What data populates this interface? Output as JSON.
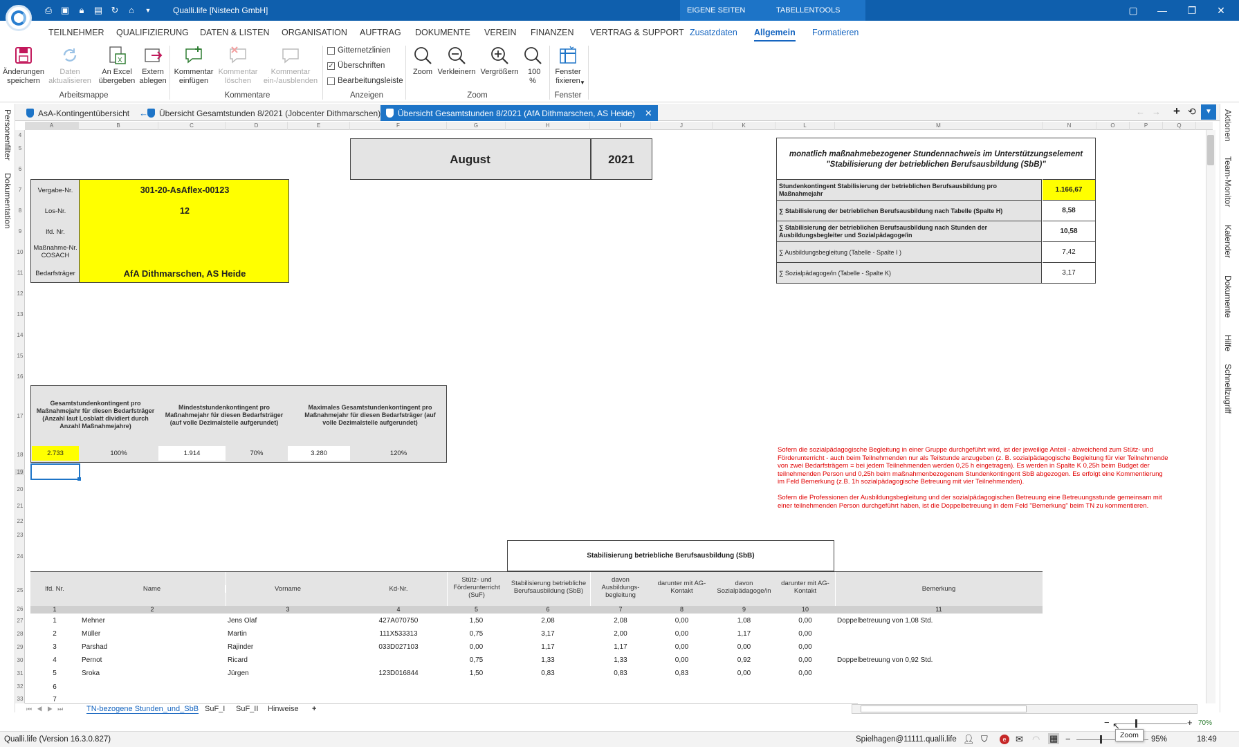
{
  "app": {
    "title": "Qualli.life [Nistech GmbH]",
    "context_tabs": [
      "EIGENE SEITEN",
      "TABELLENTOOLS"
    ]
  },
  "menu": [
    "TEILNEHMER",
    "QUALIFIZIERUNG",
    "DATEN & LISTEN",
    "ORGANISATION",
    "AUFTRAG",
    "DOKUMENTE",
    "VEREIN",
    "FINANZEN",
    "VERTRAG & SUPPORT",
    "Zusatzdaten",
    "Allgemein",
    "Formatieren"
  ],
  "ribbon": {
    "save": "Änderungen speichern",
    "refresh": "Daten aktualisieren",
    "excel": "An Excel übergeben",
    "extern": "Extern ablegen",
    "group_workbook": "Arbeitsmappe",
    "comment_add": "Kommentar einfügen",
    "comment_delete": "Kommentar löschen",
    "comment_toggle": "Kommentar ein-/ausblenden",
    "group_comments": "Kommentare",
    "grid": "Gitternetzlinien",
    "headings": "Überschriften",
    "editbar": "Bearbeitungsleiste",
    "group_show": "Anzeigen",
    "zoom": "Zoom",
    "zoom_out": "Verkleinern",
    "zoom_in": "Vergrößern",
    "zoom_100": "100 %",
    "group_zoom": "Zoom",
    "freeze": "Fenster fixieren",
    "group_window": "Fenster"
  },
  "tabs": [
    {
      "label": "AsA-Kontingentübersicht"
    },
    {
      "label": "Übersicht Gesamtstunden 8/2021 (Jobcenter Dithmarschen)"
    },
    {
      "label": "Übersicht Gesamtstunden 8/2021 (AfA Dithmarschen, AS Heide)"
    }
  ],
  "left_panel": [
    "Personenfilter",
    "Dokumentation"
  ],
  "right_panel": [
    "Aktionen",
    "Team-Monitor",
    "Kalender",
    "Dokumente",
    "Hilfe",
    "Schnellzugriff"
  ],
  "columns": [
    "A",
    "B",
    "C",
    "D",
    "E",
    "F",
    "G",
    "H",
    "I",
    "J",
    "K",
    "L",
    "M",
    "N",
    "O",
    "P",
    "Q"
  ],
  "rows": [
    "4",
    "5",
    "6",
    "7",
    "8",
    "9",
    "10",
    "11",
    "12",
    "13",
    "14",
    "15",
    "16",
    "17",
    "18",
    "19",
    "20",
    "21",
    "22",
    "23",
    "24",
    "25",
    "26",
    "27",
    "28",
    "29",
    "30",
    "31",
    "32",
    "33"
  ],
  "sheet": {
    "month": "August",
    "year": "2021",
    "info_labels": [
      "Vergabe-Nr.",
      "Los-Nr.",
      "lfd. Nr.",
      "Maßnahme-Nr. COSACH",
      "Bedarfsträger"
    ],
    "vergabe_nr": "301-20-AsAflex-00123",
    "los_nr": "12",
    "bedarfstraeger": "AfA Dithmarschen, AS Heide",
    "summary_title": "monatlich maßnahmebezogener Stundennachweis im Unterstützungselement \"Stabilisierung der betrieblichen Berufsausbildung (SbB)\"",
    "summary_rows": [
      {
        "label": "Stundenkontingent Stabilisierung der betrieblichen Berufsausbildung pro Maßnahmejahr",
        "value": "1.166,67"
      },
      {
        "label": "∑ Stabilisierung der betrieblichen Berufsausbildung nach Tabelle (Spalte H)",
        "value": "8,58"
      },
      {
        "label": "∑ Stabilisierung der betrieblichen Berufsausbildung nach Stunden der Ausbildungsbegleiter und Sozialpädagoge/in",
        "value": "10,58"
      },
      {
        "label": "∑ Ausbildungsbegleitung (Tabelle - Spalte   I )",
        "value": "7,42"
      },
      {
        "label": "∑ Sozialpädagoge/in (Tabelle - Spalte K)",
        "value": "3,17"
      }
    ],
    "quota_headers": [
      "Gesamtstundenkontingent pro Maßnahmejahr für diesen Bedarfsträger (Anzahl laut Losblatt dividiert durch Anzahl Maßnahmejahre)",
      "Mindeststundenkontingent pro Maßnahmejahr für diesen Bedarfsträger (auf volle Dezimalstelle aufgerundet)",
      "Maximales Gesamtstundenkontingent pro Maßnahmejahr für diesen Bedarfsträger (auf volle Dezimalstelle aufgerundet)"
    ],
    "quota_values": [
      "2.733",
      "100%",
      "1.914",
      "70%",
      "3.280",
      "120%"
    ],
    "note1": "Sofern die sozialpädagogische Begleitung in einer Gruppe durchgeführt wird, ist der jeweilige Anteil - abweichend zum Stütz- und Förderunterricht - auch beim Teilnehmenden nur als Teilstunde anzugeben (z. B. sozialpädagogische Begleitung für vier Teilnehmende von zwei Bedarfsträgern = bei jedem Teilnehmenden werden 0,25 h eingetragen). Es werden in Spalte K 0,25h beim Budget der teilnehmenden Person und 0,25h beim maßnahmenbezogenem Stundenkontingent SbB  abgezogen. Es erfolgt eine Kommentierung im Feld Bemerkung (z.B. 1h sozialpädagogische Betreuung mit vier Teilnehmenden).",
    "note2": "Sofern die Professionen der Ausbildungsbegleitung und der sozialpädagogischen Betreuung eine Betreuungsstunde gemeinsam mit einer teilnehmenden Person durchgeführt haben, ist die Doppelbetreuung in dem Feld \"Bemerkung\" beim TN zu kommentieren.",
    "sbb_title": "Stabilisierung betriebliche Berufsausbildung (SbB)",
    "table_headers": [
      "lfd. Nr.",
      "Name",
      "Vorname",
      "Kd-Nr.",
      "Stütz- und Förderunterricht (SuF)",
      "Stabilisierung betriebliche Berufsausbildung (SbB)",
      "davon Ausbildungs-begleitung",
      "darunter mit AG-Kontakt",
      "davon Sozialpädagoge/in",
      "darunter mit AG-Kontakt",
      "Bemerkung"
    ],
    "col_numbers": [
      "1",
      "2",
      "3",
      "4",
      "5",
      "6",
      "7",
      "8",
      "9",
      "10",
      "11"
    ],
    "table_rows": [
      [
        "1",
        "Mehner",
        "Jens Olaf",
        "427A070750",
        "1,50",
        "2,08",
        "2,08",
        "0,00",
        "1,08",
        "0,00",
        "Doppelbetreuung von 1,08 Std."
      ],
      [
        "2",
        "Müller",
        "Martin",
        "111X533313",
        "0,75",
        "3,17",
        "2,00",
        "0,00",
        "1,17",
        "0,00",
        ""
      ],
      [
        "3",
        "Parshad",
        "Rajinder",
        "033D027103",
        "0,00",
        "1,17",
        "1,17",
        "0,00",
        "0,00",
        "0,00",
        ""
      ],
      [
        "4",
        "Pernot",
        "Ricard",
        "",
        "0,75",
        "1,33",
        "1,33",
        "0,00",
        "0,92",
        "0,00",
        "Doppelbetreuung von 0,92 Std."
      ],
      [
        "5",
        "Sroka",
        "Jürgen",
        "123D016844",
        "1,50",
        "0,83",
        "0,83",
        "0,83",
        "0,00",
        "0,00",
        ""
      ],
      [
        "6",
        "",
        "",
        "",
        "",
        "",
        "",
        "",
        "",
        "",
        ""
      ],
      [
        "7",
        "",
        "",
        "",
        "",
        "",
        "",
        "",
        "",
        "",
        ""
      ]
    ]
  },
  "sheet_tabs": [
    "TN-bezogene Stunden_und_SbB",
    "SuF_I",
    "SuF_II",
    "Hinweise",
    "+"
  ],
  "zoom": {
    "level": "70%",
    "tooltip": "Zoom"
  },
  "status": {
    "version": "Qualli.life (Version 16.3.0.827)",
    "user": "Spielhagen@11111.qualli.life",
    "zoom": "95%",
    "time": "18:49"
  }
}
